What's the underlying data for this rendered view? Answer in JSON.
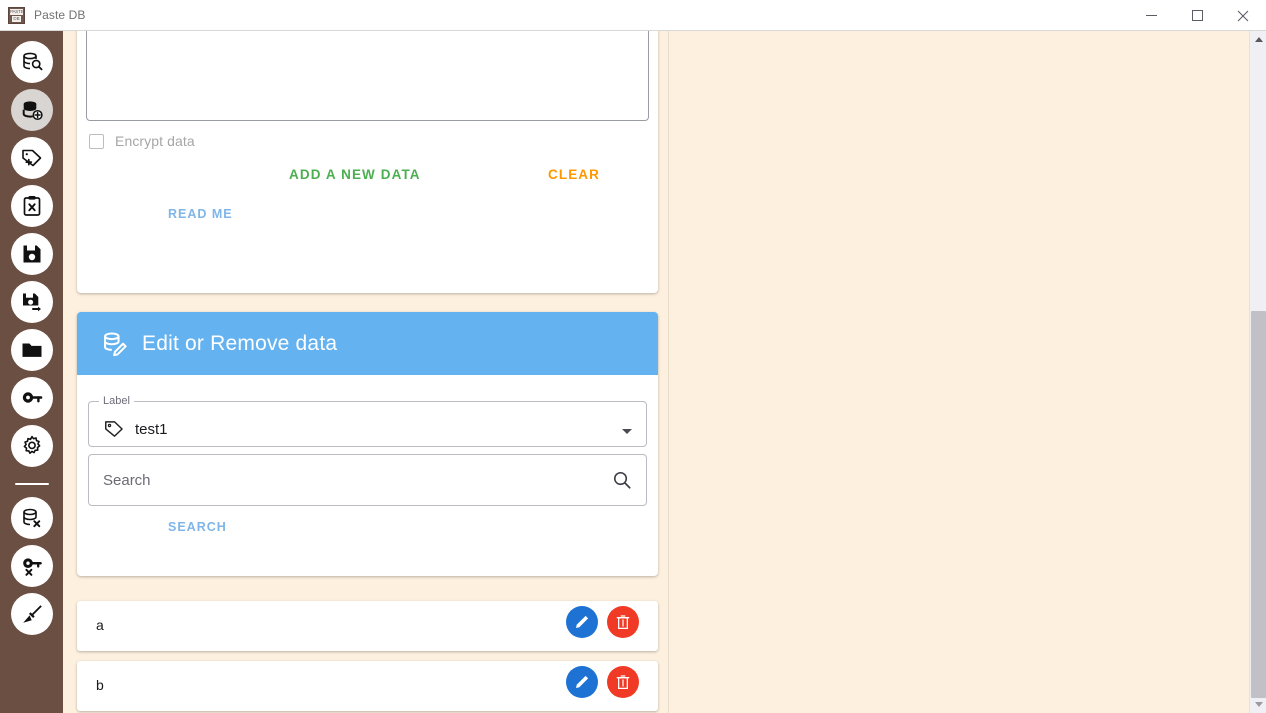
{
  "window": {
    "title": "Paste DB",
    "icon_top_text": "PASTE",
    "icon_bottom_text": "DB",
    "minimize_label": "Minimize",
    "maximize_label": "Maximize",
    "close_label": "Close"
  },
  "theme": {
    "sidebar_bg": "#6b4f43",
    "page_bg": "#fdf0de",
    "card_header_blue": "#64b2f0",
    "add_green": "#4caf50",
    "clear_orange": "#ff9800",
    "link_blue": "#7fb5e8",
    "edit_button_blue": "#1d72d4",
    "delete_button_red": "#f03a26"
  },
  "sidebar": {
    "items": [
      {
        "name": "search-database",
        "icon": "database-search-icon",
        "active": false
      },
      {
        "name": "add-database",
        "icon": "database-add-icon",
        "active": true
      },
      {
        "name": "add-label",
        "icon": "tag-add-icon",
        "active": false
      },
      {
        "name": "clipboard-remove",
        "icon": "clipboard-x-icon",
        "active": false
      },
      {
        "name": "save",
        "icon": "floppy-save-icon",
        "active": false
      },
      {
        "name": "save-as",
        "icon": "floppy-export-icon",
        "active": false
      },
      {
        "name": "open-file",
        "icon": "folder-open-icon",
        "active": false
      },
      {
        "name": "password",
        "icon": "key-icon",
        "active": false
      },
      {
        "name": "settings",
        "icon": "gear-icon",
        "active": false
      }
    ],
    "items_bottom": [
      {
        "name": "delete-database",
        "icon": "database-x-icon",
        "active": false
      },
      {
        "name": "remove-password",
        "icon": "key-x-icon",
        "active": false
      },
      {
        "name": "clean-up",
        "icon": "broom-icon",
        "active": false
      }
    ]
  },
  "add_card": {
    "textarea_value": "",
    "textarea_placeholder": "",
    "encrypt_checkbox_label": "Encrypt data",
    "encrypt_checked": false,
    "add_button_label": "ADD A NEW DATA",
    "clear_button_label": "CLEAR",
    "readme_link_label": "READ ME"
  },
  "edit_card": {
    "header_title": "Edit or Remove data",
    "header_icon": "database-edit-icon",
    "label_field": {
      "legend": "Label",
      "selected_value": "test1",
      "icon": "tag-icon",
      "caret": "chevron-down-icon"
    },
    "search_field": {
      "value": "",
      "placeholder": "Search",
      "icon": "search-icon"
    },
    "search_button_label": "SEARCH"
  },
  "results": [
    {
      "text": "a",
      "edit_icon": "pencil-icon",
      "delete_icon": "trash-icon"
    },
    {
      "text": "b",
      "edit_icon": "pencil-icon",
      "delete_icon": "trash-icon"
    }
  ],
  "scrollbar": {
    "up_arrow": "caret-up-icon",
    "down_arrow": "caret-down-icon",
    "thumb": "scroll-thumb"
  }
}
